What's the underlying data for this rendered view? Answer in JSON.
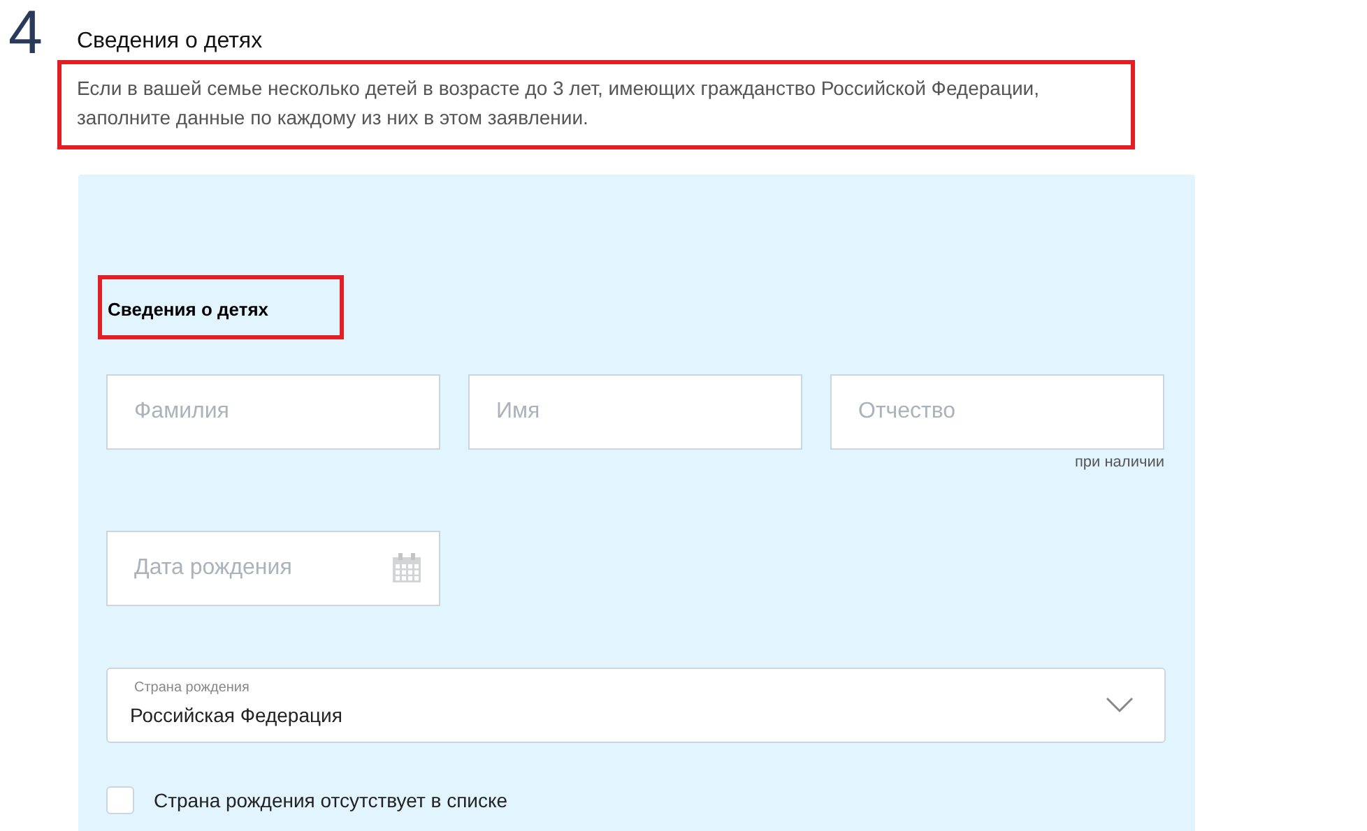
{
  "step": {
    "number": "4",
    "title": "Сведения о детях",
    "note": "Если в вашей семье несколько детей в возрасте до 3 лет, имеющих гражданство Российской Федерации, заполните данные по каждому из них в этом заявлении.",
    "note_highlighted": true
  },
  "form": {
    "title": "Сведения о детях",
    "title_highlighted": true,
    "name_fields": [
      {
        "placeholder": "Фамилия"
      },
      {
        "placeholder": "Имя"
      },
      {
        "placeholder": "Отчество",
        "hint": "при наличии"
      }
    ],
    "birth_date": {
      "placeholder": "Дата рождения"
    },
    "country": {
      "label": "Страна рождения",
      "value": "Российская Федерация"
    },
    "country_missing": {
      "label": "Страна рождения отсутствует в списке",
      "checked": false
    }
  }
}
